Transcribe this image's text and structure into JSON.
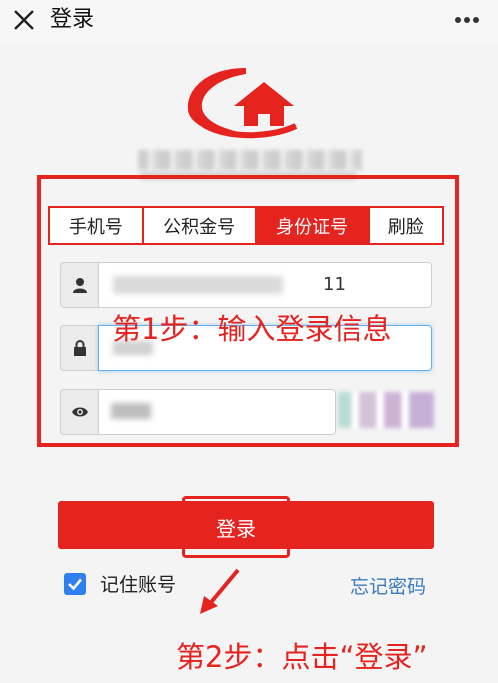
{
  "header": {
    "title": "登录"
  },
  "tabs": [
    {
      "label": "手机号",
      "active": false
    },
    {
      "label": "公积金号",
      "active": false
    },
    {
      "label": "身份证号",
      "active": true
    },
    {
      "label": "刷脸",
      "active": false
    }
  ],
  "form": {
    "id_number_suffix": "11",
    "login_label": "登录",
    "remember_label": "记住账号",
    "remember_checked": true,
    "forgot_label": "忘记密码"
  },
  "annotations": {
    "step1": "第1步：输入登录信息",
    "step2": "第2步：点击“登录”"
  },
  "icons": {
    "close": "close-icon",
    "more": "more-icon",
    "user": "user-icon",
    "lock": "lock-icon",
    "eye": "eye-icon",
    "check": "check-icon",
    "arrow": "arrow-icon"
  },
  "colors": {
    "accent": "#e5231f",
    "link": "#3a7bbf",
    "checkbox": "#2f80ed"
  }
}
